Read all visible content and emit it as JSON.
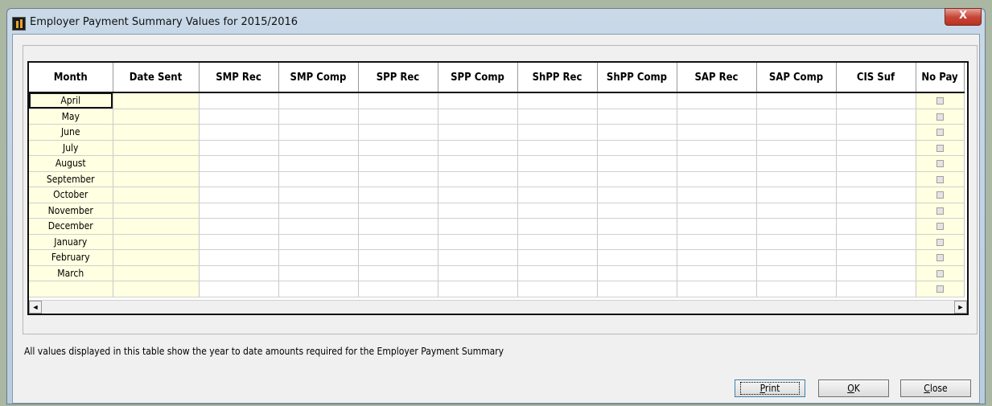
{
  "window": {
    "title": "Employer Payment Summary Values for 2015/2016",
    "close_glyph": "X"
  },
  "table": {
    "headers": [
      "Month",
      "Date Sent",
      "SMP Rec",
      "SMP Comp",
      "SPP Rec",
      "SPP Comp",
      "ShPP Rec",
      "ShPP Comp",
      "SAP Rec",
      "SAP Comp",
      "CIS Suf",
      "No Pay"
    ],
    "months": [
      "April",
      "May",
      "June",
      "July",
      "August",
      "September",
      "October",
      "November",
      "December",
      "January",
      "February",
      "March",
      ""
    ]
  },
  "footnote": "All values displayed in this table show the year to date amounts required for the Employer Payment Summary",
  "buttons": {
    "print": {
      "label": "Print",
      "mnemonic": "P",
      "rest": "rint"
    },
    "ok": {
      "label": "OK",
      "mnemonic": "O",
      "rest": "K"
    },
    "close": {
      "label": "Close",
      "mnemonic": "C",
      "rest": "lose"
    }
  },
  "scrollbar": {
    "left_glyph": "◄",
    "right_glyph": "►"
  }
}
